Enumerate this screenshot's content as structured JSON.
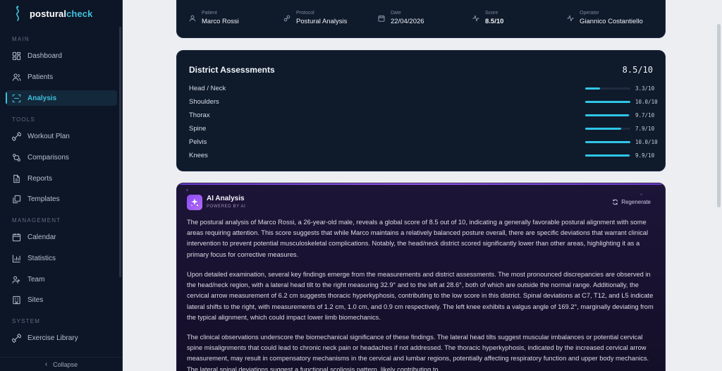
{
  "app": {
    "logo_main": "postural",
    "logo_accent": "check"
  },
  "sidebar": {
    "sections": {
      "main": "MAIN",
      "tools": "TOOLS",
      "management": "MANAGEMENT",
      "system": "SYSTEM"
    },
    "items": [
      {
        "label": "Dashboard",
        "icon": "grid-icon"
      },
      {
        "label": "Patients",
        "icon": "users-icon"
      },
      {
        "label": "Analysis",
        "icon": "scan-icon",
        "active": true
      },
      {
        "label": "Workout Plan",
        "icon": "dumbbell-icon"
      },
      {
        "label": "Comparisons",
        "icon": "compare-icon"
      },
      {
        "label": "Reports",
        "icon": "file-icon"
      },
      {
        "label": "Templates",
        "icon": "copy-icon"
      },
      {
        "label": "Calendar",
        "icon": "calendar-icon"
      },
      {
        "label": "Statistics",
        "icon": "bar-chart-icon"
      },
      {
        "label": "Team",
        "icon": "team-icon"
      },
      {
        "label": "Sites",
        "icon": "building-icon"
      },
      {
        "label": "Exercise Library",
        "icon": "dumbbell-icon"
      }
    ],
    "collapse_label": "Collapse"
  },
  "info": {
    "patient": {
      "label": "Patient",
      "value": "Marco Rossi"
    },
    "protocol": {
      "label": "Protocol",
      "value": "Postural Analysis"
    },
    "date": {
      "label": "Date",
      "value": "22/04/2026"
    },
    "score": {
      "label": "Score",
      "value": "8.5/10"
    },
    "operator": {
      "label": "Operator",
      "value": "Giannico Costantiello"
    }
  },
  "district": {
    "title": "District Assessments",
    "score": "8.5/10",
    "rows": [
      {
        "name": "Head / Neck",
        "value": 3.3,
        "label": "3.3/10"
      },
      {
        "name": "Shoulders",
        "value": 10.0,
        "label": "10.0/10"
      },
      {
        "name": "Thorax",
        "value": 9.7,
        "label": "9.7/10"
      },
      {
        "name": "Spine",
        "value": 7.9,
        "label": "7.9/10"
      },
      {
        "name": "Pelvis",
        "value": 10.0,
        "label": "10.0/10"
      },
      {
        "name": "Knees",
        "value": 9.9,
        "label": "9.9/10"
      }
    ]
  },
  "ai": {
    "title": "AI Analysis",
    "subtitle": "POWERED BY AI",
    "regenerate": "Regenerate",
    "paragraphs": [
      "The postural analysis of Marco Rossi, a 26-year-old male, reveals a global score of 8.5 out of 10, indicating a generally favorable postural alignment with some areas requiring attention. This score suggests that while Marco maintains a relatively balanced posture overall, there are specific deviations that warrant clinical intervention to prevent potential musculoskeletal complications. Notably, the head/neck district scored significantly lower than other areas, highlighting it as a primary focus for corrective measures.",
      "Upon detailed examination, several key findings emerge from the measurements and district assessments. The most pronounced discrepancies are observed in the head/neck region, with a lateral head tilt to the right measuring 32.9° and to the left at 28.6°, both of which are outside the normal range. Additionally, the cervical arrow measurement of 6.2 cm suggests thoracic hyperkyphosis, contributing to the low score in this district. Spinal deviations at C7, T12, and L5 indicate lateral shifts to the right, with measurements of 1.2 cm, 1.0 cm, and 0.9 cm respectively. The left knee exhibits a valgus angle of 169.2°, marginally deviating from the typical alignment, which could impact lower limb biomechanics.",
      "The clinical observations underscore the biomechanical significance of these findings. The lateral head tilts suggest muscular imbalances or potential cervical spine misalignments that could lead to chronic neck pain or headaches if not addressed. The thoracic hyperkyphosis, indicated by the increased cervical arrow measurement, may result in compensatory mechanisms in the cervical and lumbar regions, potentially affecting respiratory function and upper body mechanics. The lateral spinal deviations suggest a functional scoliosis pattern, likely contributing to"
    ]
  },
  "colors": {
    "accent": "#2fc6e6",
    "sidebar_bg": "#0d1626",
    "card_bg": "#0f1a2b",
    "ai_accent": "#9b5cf0"
  }
}
